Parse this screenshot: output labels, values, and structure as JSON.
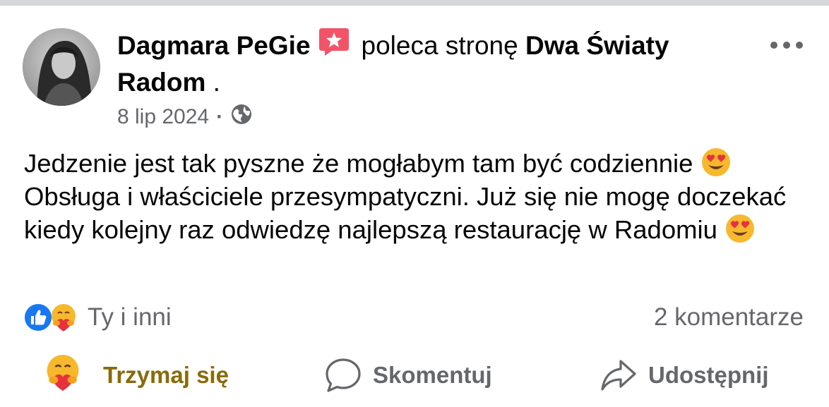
{
  "post": {
    "author": "Dagmara PeGie",
    "action_text": "poleca stronę",
    "page_name_line1": "Dwa Światy",
    "page_name_line2": "Radom",
    "page_suffix": " .",
    "date": "8 lip 2024",
    "separator": "·",
    "audience_icon": "globe-icon",
    "text_part1": "Jedzenie jest tak pyszne że mogłabym tam być codziennie",
    "text_part2": " Obsługa i właściciele przesympatyczni. Już się nie mogę doczekać kiedy kolejny raz odwiedzę najlepszą restaurację w Radomiu",
    "emoji": "smiling-face-with-heart-eyes"
  },
  "reactions": {
    "summary": "Ty i inni",
    "icons": [
      "like-icon",
      "care-icon"
    ],
    "comments": "2 komentarze"
  },
  "actions": {
    "react_label": "Trzymaj się",
    "comment_label": "Skomentuj",
    "share_label": "Udostępnij"
  },
  "colors": {
    "primary_text": "#050505",
    "secondary_text": "#65676b",
    "care_reaction": "#8a6a0a",
    "like_blue": "#1877f2",
    "badge_pink": "#f35369"
  }
}
